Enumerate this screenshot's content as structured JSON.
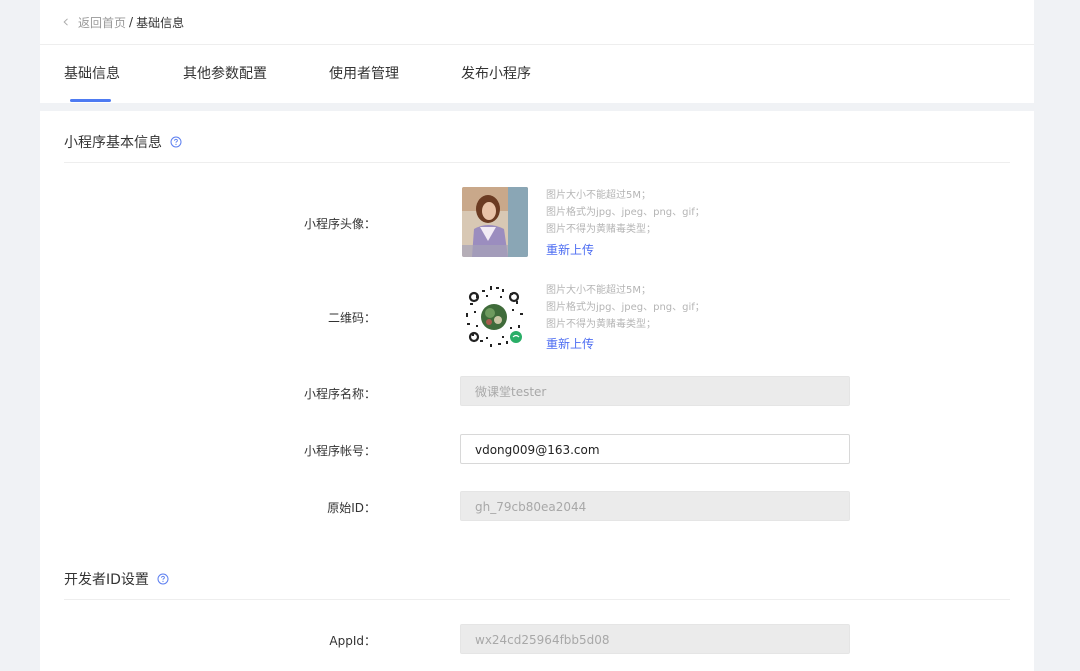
{
  "breadcrumb": {
    "back_label": "返回首页",
    "separator": "/",
    "current": "基础信息"
  },
  "tabs": [
    {
      "label": "基础信息",
      "active": true
    },
    {
      "label": "其他参数配置",
      "active": false
    },
    {
      "label": "使用者管理",
      "active": false
    },
    {
      "label": "发布小程序",
      "active": false
    }
  ],
  "basic_section": {
    "title": "小程序基本信息",
    "avatar": {
      "label": "小程序头像：",
      "hints": [
        "图片大小不能超过5M；",
        "图片格式为jpg、jpeg、png、gif；",
        "图片不得为黄赌毒类型；"
      ],
      "action": "重新上传"
    },
    "qrcode": {
      "label": "二维码：",
      "hints": [
        "图片大小不能超过5M；",
        "图片格式为jpg、jpeg、png、gif；",
        "图片不得为黄赌毒类型；"
      ],
      "action": "重新上传"
    },
    "name": {
      "label": "小程序名称：",
      "value": "微课堂tester",
      "disabled": true
    },
    "account": {
      "label": "小程序帐号：",
      "value": "vdong009@163.com",
      "disabled": false
    },
    "origin_id": {
      "label": "原始ID：",
      "value": "gh_79cb80ea2044",
      "disabled": true
    }
  },
  "developer_section": {
    "title": "开发者ID设置",
    "appid": {
      "label": "AppId：",
      "value": "wx24cd25964fbb5d08",
      "disabled": true
    }
  },
  "colors": {
    "accent": "#4e7bf2",
    "link": "#4e6ef2",
    "background": "#f0f2f5"
  },
  "icons": [
    "chevron-left-icon",
    "help-circle-icon"
  ]
}
